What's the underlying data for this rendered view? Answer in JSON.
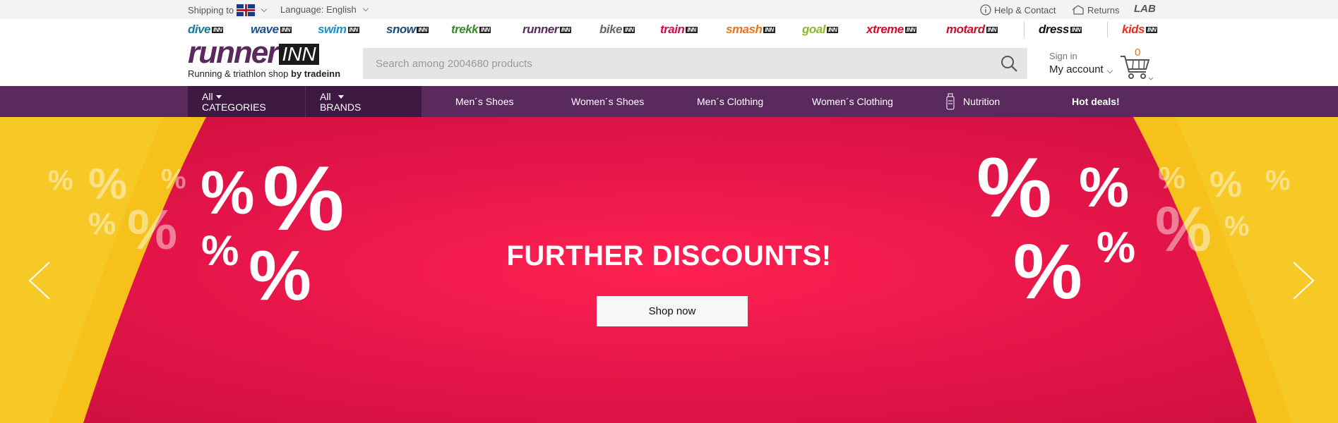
{
  "topbar": {
    "shipping_label": "Shipping to",
    "language_label": "Language: English",
    "help_label": "Help & Contact",
    "returns_label": "Returns",
    "lab_label": "LAB"
  },
  "stores": [
    {
      "name": "dive",
      "color": "#1a7a9a"
    },
    {
      "name": "wave",
      "color": "#1b4f8a"
    },
    {
      "name": "swim",
      "color": "#1a8fd0"
    },
    {
      "name": "snow",
      "color": "#1a4a7a"
    },
    {
      "name": "trekk",
      "color": "#3a8a2a"
    },
    {
      "name": "runner",
      "color": "#5a2a5e"
    },
    {
      "name": "bike",
      "color": "#666666"
    },
    {
      "name": "train",
      "color": "#c8104a"
    },
    {
      "name": "smash",
      "color": "#e8731a"
    },
    {
      "name": "goal",
      "color": "#8ab82a"
    },
    {
      "name": "xtreme",
      "color": "#d0102a"
    },
    {
      "name": "motard",
      "color": "#c8102a"
    },
    {
      "name": "dress",
      "color": "#111111"
    },
    {
      "name": "kids",
      "color": "#e8301a"
    }
  ],
  "logo": {
    "main": "runner",
    "inn": "INN",
    "tagline": "Running & triathlon shop",
    "by": "by tradeinn"
  },
  "search": {
    "placeholder": "Search among 2004680 products"
  },
  "account": {
    "signin": "Sign in",
    "my_account": "My account"
  },
  "cart": {
    "count": "0"
  },
  "nav": {
    "all_categories_1": "All",
    "all_categories_2": "CATEGORIES",
    "all_brands_1": "All",
    "all_brands_2": "BRANDS",
    "links": [
      "Men´s Shoes",
      "Women´s Shoes",
      "Men´s Clothing",
      "Women´s Clothing",
      "Nutrition",
      "Hot deals!"
    ]
  },
  "hero": {
    "title": "FURTHER DISCOUNTS!",
    "button": "Shop now",
    "symbol": "%"
  },
  "colors": {
    "brand_purple": "#5a2a5e",
    "hero_red": "#e8164a",
    "hero_yellow": "#f5c11a",
    "cart_count": "#e8731a"
  }
}
